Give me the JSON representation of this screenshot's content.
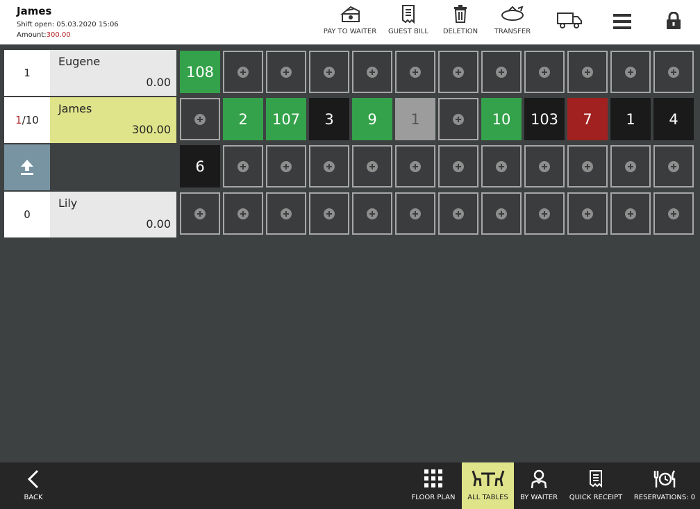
{
  "header": {
    "waiter_name": "James",
    "shift_label": "Shift open: 05.03.2020 15:06",
    "amount_label": "Amount:",
    "amount_value": "300.00"
  },
  "toolbar": {
    "pay_to_waiter": "PAY TO WAITER",
    "guest_bill": "GUEST BILL",
    "deletion": "DELETION",
    "transfer": "TRANSFER"
  },
  "waiters": [
    {
      "count": "1",
      "name": "Eugene",
      "amount": "0.00"
    },
    {
      "count_active": "1",
      "count_total": "/10",
      "name": "James",
      "amount": "300.00"
    },
    {
      "count": "0",
      "name": "Lily",
      "amount": "0.00"
    }
  ],
  "tables": {
    "row1": [
      "108"
    ],
    "row2": [
      "2",
      "107",
      "3",
      "9",
      "1",
      "10",
      "103",
      "7",
      "1",
      "4"
    ],
    "row3": [
      "6"
    ]
  },
  "footer": {
    "back": "BACK",
    "floor_plan": "FLOOR PLAN",
    "all_tables": "ALL TABLES",
    "by_waiter": "BY WAITER",
    "quick_receipt": "QUICK RECEIPT",
    "reservations": "RESERVATIONS: 0"
  },
  "colors": {
    "occupied": "#34a24a",
    "closed": "#1a1a1a",
    "pending": "#9c9c9c",
    "alert": "#a0211f",
    "selected": "#dfe38a"
  }
}
